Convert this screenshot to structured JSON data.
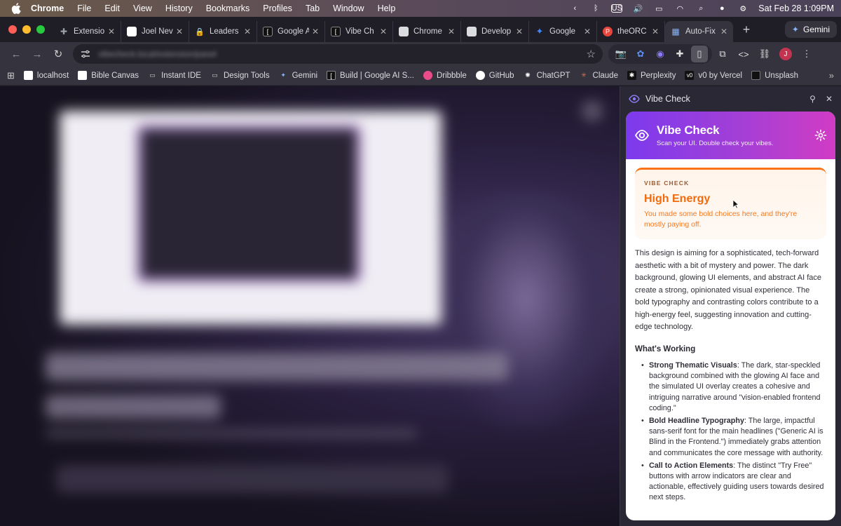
{
  "menubar": {
    "app": "Chrome",
    "items": [
      "File",
      "Edit",
      "View",
      "History",
      "Bookmarks",
      "Profiles",
      "Tab",
      "Window",
      "Help"
    ],
    "input_badge": "US",
    "datetime": "Sat Feb 28  1:09PM"
  },
  "tabs": [
    {
      "label": "Extensio",
      "icon": "puzzle-icon",
      "color": "#9aa0a6"
    },
    {
      "label": "Joel Nev",
      "icon": "page-icon",
      "color": "#ffffff"
    },
    {
      "label": "Leaders",
      "icon": "lock-icon",
      "color": "#f4b400"
    },
    {
      "label": "Google A",
      "icon": "bracket-icon",
      "color": "#111111"
    },
    {
      "label": "Vibe Ch",
      "icon": "bracket-icon",
      "color": "#111111"
    },
    {
      "label": "Chrome",
      "icon": "store-icon",
      "color": "#dadce0"
    },
    {
      "label": "Develop",
      "icon": "store-icon",
      "color": "#dadce0"
    },
    {
      "label": "Google",
      "icon": "gemini-icon",
      "color": "#4285f4"
    },
    {
      "label": "theORC",
      "icon": "p-icon",
      "color": "#e8453c"
    },
    {
      "label": "Auto-Fix",
      "icon": "grid-icon",
      "color": "#8ab4f8",
      "active": true
    }
  ],
  "gemini_button": "Gemini",
  "omnibox": {
    "url": "vibecheck.local/extension/panel"
  },
  "profile_initial": "J",
  "bookmarks": [
    {
      "label": "localhost",
      "icon": "page-icon"
    },
    {
      "label": "Bible Canvas",
      "icon": "page-icon"
    },
    {
      "label": "Instant IDE",
      "icon": "folder-icon"
    },
    {
      "label": "Design Tools",
      "icon": "folder-icon"
    },
    {
      "label": "Gemini",
      "icon": "gemini-icon"
    },
    {
      "label": "Build | Google AI S...",
      "icon": "bracket-icon"
    },
    {
      "label": "Dribbble",
      "icon": "dribbble-icon"
    },
    {
      "label": "GitHub",
      "icon": "github-icon"
    },
    {
      "label": "ChatGPT",
      "icon": "openai-icon"
    },
    {
      "label": "Claude",
      "icon": "claude-icon"
    },
    {
      "label": "Perplexity",
      "icon": "perplexity-icon"
    },
    {
      "label": "v0 by Vercel",
      "icon": "v0-icon"
    },
    {
      "label": "Unsplash",
      "icon": "unsplash-icon"
    }
  ],
  "sidepanel": {
    "title": "Vibe Check",
    "app_name": "Vibe Check",
    "tagline": "Scan your UI. Double check your vibes.",
    "verdict": {
      "label": "VIBE CHECK",
      "title": "High Energy",
      "description": "You made some bold choices here, and they're mostly paying off."
    },
    "summary": "This design is aiming for a sophisticated, tech-forward aesthetic with a bit of mystery and power. The dark background, glowing UI elements, and abstract AI face create a strong, opinionated visual experience. The bold typography and contrasting colors contribute to a high-energy feel, suggesting innovation and cutting-edge technology.",
    "working_heading": "What's Working",
    "points": [
      {
        "title": "Strong Thematic Visuals",
        "text": ": The dark, star-speckled background combined with the glowing AI face and the simulated UI overlay creates a cohesive and intriguing narrative around \"vision-enabled frontend coding.\""
      },
      {
        "title": "Bold Headline Typography",
        "text": ": The large, impactful sans-serif font for the main headlines (\"Generic AI is Blind in the Frontend.\") immediately grabs attention and communicates the core message with authority."
      },
      {
        "title": "Call to Action Elements",
        "text": ": The distinct \"Try Free\" buttons with arrow indicators are clear and actionable, effectively guiding users towards desired next steps."
      }
    ]
  },
  "colors": {
    "accent_orange": "#f26a0c",
    "gradient_start": "#7c3aed",
    "gradient_end": "#d13cc4"
  }
}
